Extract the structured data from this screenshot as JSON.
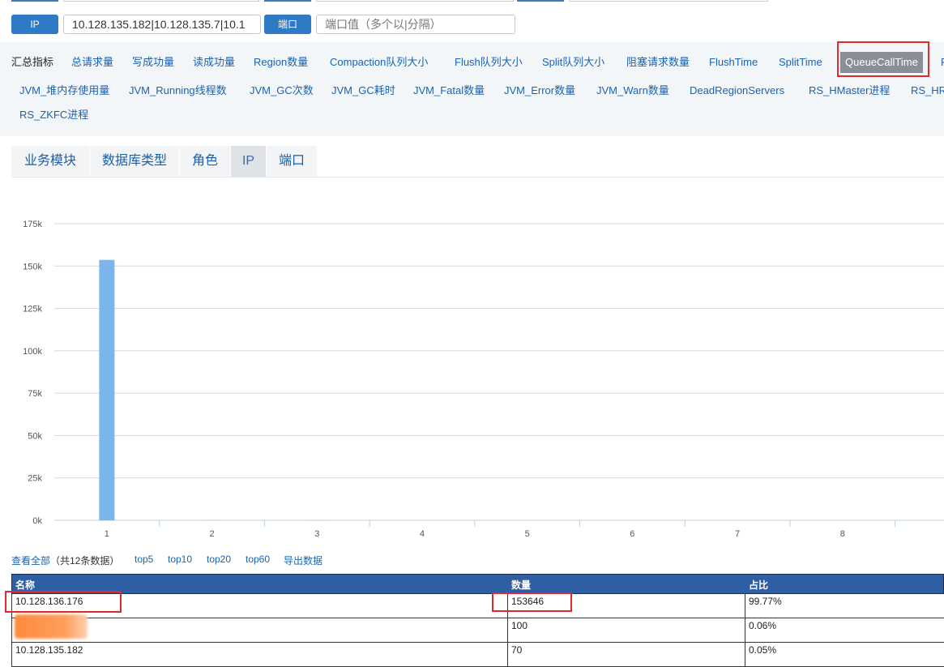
{
  "filters": {
    "ip_label": "IP",
    "ip_value": "10.128.135.182|10.128.135.7|10.1",
    "port_label": "端口",
    "port_placeholder": "端口值（多个以|分隔）"
  },
  "metrics": {
    "row1": [
      "汇总指标",
      "总请求量",
      "写成功量",
      "读成功量",
      "Region数量",
      "Compaction队列大小",
      "Flush队列大小",
      "Split队列大小",
      "阻塞请求数量",
      "FlushTime",
      "SplitTime",
      "QueueCallTime",
      "F"
    ],
    "row2": [
      "JVM_堆内存使用量",
      "JVM_Running线程数",
      "JVM_GC次数",
      "JVM_GC耗时",
      "JVM_Fatal数量",
      "JVM_Error数量",
      "JVM_Warn数量",
      "DeadRegionServers",
      "RS_HMaster进程",
      "RS_HR"
    ],
    "row3": [
      "RS_ZKFC进程"
    ],
    "active": "QueueCallTime"
  },
  "tabs": [
    "业务模块",
    "数据库类型",
    "角色",
    "IP",
    "端口"
  ],
  "active_tab": "IP",
  "chart_data": {
    "type": "bar",
    "categories": [
      "1",
      "2",
      "3",
      "4",
      "5",
      "6",
      "7",
      "8"
    ],
    "values": [
      153646,
      100,
      70,
      0,
      0,
      0,
      0,
      0
    ],
    "ylim": [
      0,
      175000
    ],
    "y_ticks": [
      "0k",
      "25k",
      "50k",
      "75k",
      "100k",
      "125k",
      "150k",
      "175k"
    ],
    "bar_color": "#7cb5ec",
    "grid": true,
    "legend": "none"
  },
  "links": {
    "view_all": "查看全部",
    "count_text": "（共12条数据）",
    "top5": "top5",
    "top10": "top10",
    "top20": "top20",
    "top60": "top60",
    "export": "导出数据"
  },
  "table": {
    "headers": [
      "名称",
      "数量",
      "占比"
    ],
    "rows": [
      [
        "10.128.136.176",
        "153646",
        "99.77%"
      ],
      [
        "1",
        "100",
        "0.06%"
      ],
      [
        "10.128.135.182",
        "70",
        "0.05%"
      ]
    ]
  },
  "colors": {
    "accent": "#2f7ac4",
    "highlight": "#e0282e",
    "header_bg": "#2e5fa4"
  }
}
